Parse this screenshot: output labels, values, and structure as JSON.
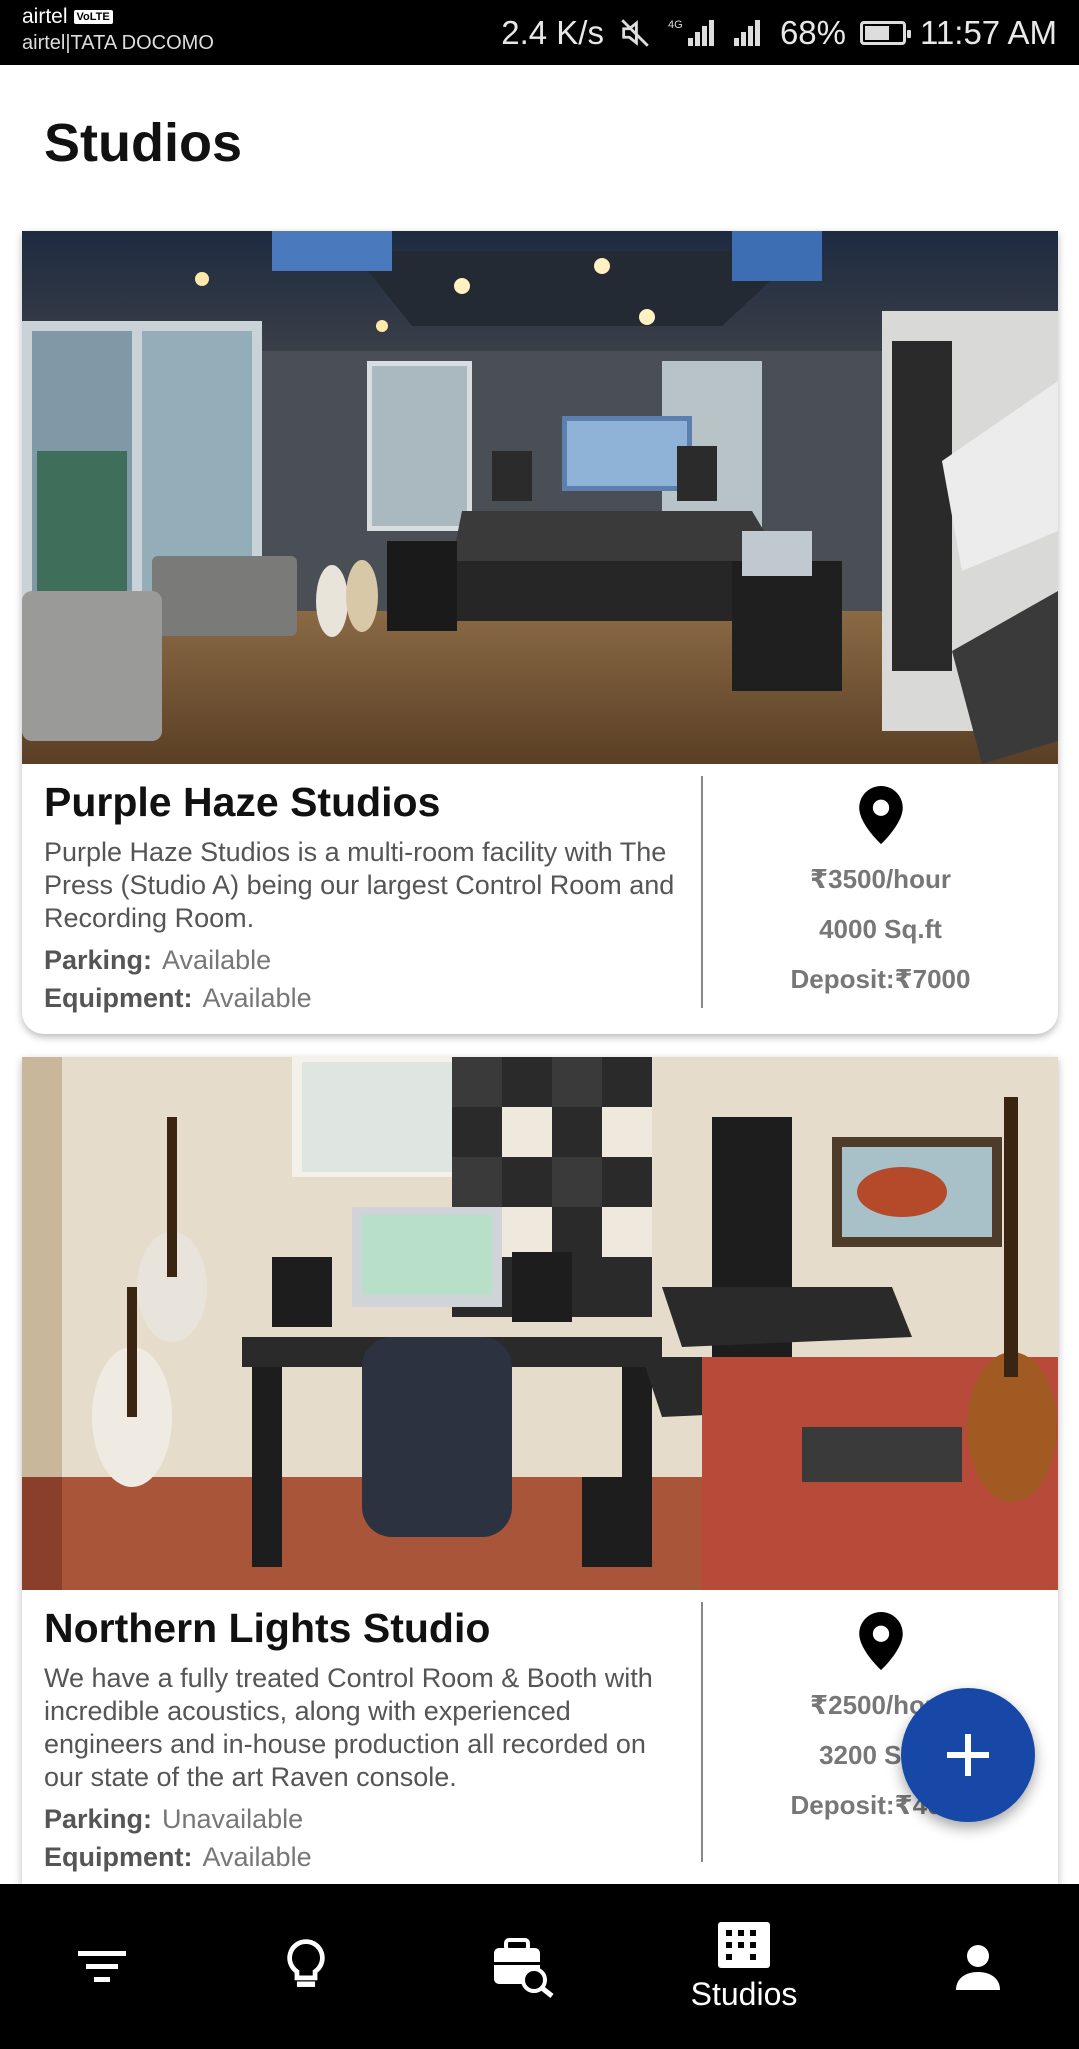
{
  "status_bar": {
    "carrier_primary": "airtel",
    "volte_badge": "VoLTE",
    "carrier_secondary": "airtel|TATA DOCOMO",
    "net_speed": "2.4 K/s",
    "network_type": "4G",
    "battery": "68%",
    "battery_level": 0.68,
    "time": "11:57 AM",
    "icons": [
      "mute-icon",
      "signal-icon",
      "signal-icon",
      "battery-icon"
    ]
  },
  "header": {
    "title": "Studios"
  },
  "studios": [
    {
      "name": "Purple Haze Studios",
      "description": "Purple Haze Studios is a multi-room facility with The Press (Studio A) being our largest Control Room and Recording Room.",
      "parking_label": "Parking:",
      "parking_value": "Available",
      "equipment_label": "Equipment:",
      "equipment_value": "Available",
      "price": "₹3500/hour",
      "area": "4000 Sq.ft",
      "deposit": "Deposit:₹7000",
      "image": "studio-photo-control-room"
    },
    {
      "name": "Northern Lights Studio",
      "description": "We have a fully treated Control Room & Booth with incredible acoustics, along with experienced engineers and in-house production all recorded on our state of the art Raven console.",
      "parking_label": "Parking:",
      "parking_value": "Unavailable",
      "equipment_label": "Equipment:",
      "equipment_value": "Available",
      "price": "₹2500/hour",
      "area": "3200 Sq.ft",
      "deposit": "Deposit:₹4000",
      "image": "studio-photo-home-studio"
    }
  ],
  "fab": {
    "icon": "plus-icon",
    "color": "#1748a8"
  },
  "bottom_nav": {
    "items": [
      {
        "icon": "filter-icon",
        "label": ""
      },
      {
        "icon": "lightbulb-icon",
        "label": ""
      },
      {
        "icon": "briefcase-search-icon",
        "label": ""
      },
      {
        "icon": "building-icon",
        "label": "Studios",
        "active": true
      },
      {
        "icon": "person-icon",
        "label": ""
      }
    ]
  },
  "colors": {
    "accent": "#1748a8",
    "nav_bg": "#000000",
    "status_bg": "#000000"
  }
}
